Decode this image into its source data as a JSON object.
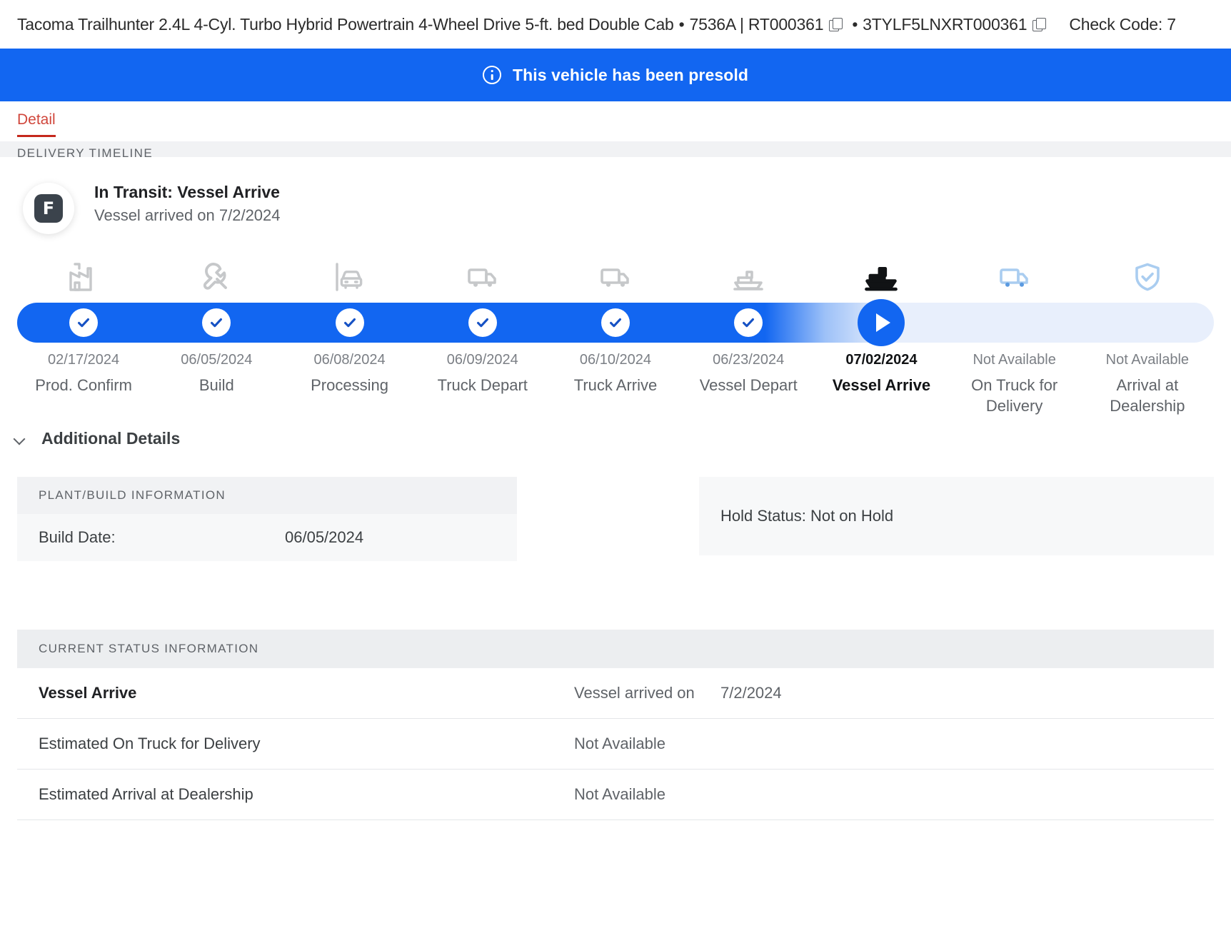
{
  "vehicle_header": {
    "description": "Tacoma Trailhunter 2.4L 4-Cyl. Turbo Hybrid Powertrain 4-Wheel Drive 5-ft. bed Double Cab",
    "bullet1": "•",
    "stock_order": "7536A | RT000361",
    "copy_icon_1": "copy-icon",
    "bullet2": "•",
    "vin": "3TYLF5LNXRT000361",
    "copy_icon_2": "copy-icon",
    "check_code": "Check Code: 7"
  },
  "banner": {
    "icon": "info-circle-icon",
    "text": "This vehicle has been presold",
    "background": "#1266f1",
    "text_color": "#ffffff"
  },
  "tabs": [
    {
      "label": "Detail",
      "active": true
    }
  ],
  "timeline_section": {
    "band_label": "DELIVERY TIMELINE",
    "brand_badge": "F",
    "status_prefix": "In Transit:",
    "status_step": "Vessel Arrive",
    "status_sub": "Vessel arrived on 7/2/2024"
  },
  "steps": [
    {
      "icon": "factory-icon",
      "date": "02/17/2024",
      "name": "Prod. Confirm",
      "state": "done"
    },
    {
      "icon": "wrench-icon",
      "date": "06/05/2024",
      "name": "Build",
      "state": "done"
    },
    {
      "icon": "car-bay-icon",
      "date": "06/08/2024",
      "name": "Processing",
      "state": "done"
    },
    {
      "icon": "truck-icon",
      "date": "06/09/2024",
      "name": "Truck Depart",
      "state": "done"
    },
    {
      "icon": "truck-icon",
      "date": "06/10/2024",
      "name": "Truck Arrive",
      "state": "done"
    },
    {
      "icon": "ship-icon",
      "date": "06/23/2024",
      "name": "Vessel Depart",
      "state": "done"
    },
    {
      "icon": "ship-icon",
      "date": "07/02/2024",
      "name": "Vessel Arrive",
      "state": "current"
    },
    {
      "icon": "truck-icon",
      "date": "Not Available",
      "name": "On Truck for Delivery",
      "state": "upcoming"
    },
    {
      "icon": "shield-check-icon",
      "date": "Not Available",
      "name": "Arrival at Dealership",
      "state": "upcoming"
    }
  ],
  "additional_details": {
    "chevron_icon": "chevron-down-icon",
    "title": "Additional Details"
  },
  "plant_build": {
    "header": "PLANT/BUILD INFORMATION",
    "rows": [
      {
        "key": "Build Date:",
        "value": "06/05/2024"
      }
    ]
  },
  "hold": {
    "text": "Hold Status: Not on Hold"
  },
  "current_status": {
    "header": "CURRENT STATUS INFORMATION",
    "rows": [
      {
        "c1": "Vessel Arrive",
        "c2": "Vessel arrived on",
        "c3": "7/2/2024",
        "bold": true
      },
      {
        "c1": "Estimated On Truck for Delivery",
        "c2": "Not Available",
        "c3": "",
        "bold": false
      },
      {
        "c1": "Estimated Arrival at Dealership",
        "c2": "Not Available",
        "c3": "",
        "bold": false
      }
    ]
  },
  "colors": {
    "brand_blue": "#1266f1",
    "tab_red": "#c5281c",
    "track_light": "#e8effc",
    "icon_gray": "#c6c8ca",
    "icon_light_blue": "#aacdf0"
  }
}
